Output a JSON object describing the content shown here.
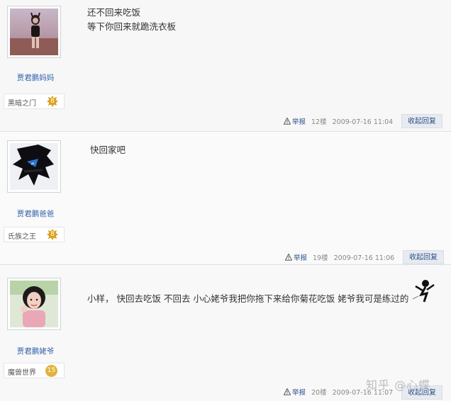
{
  "posts": [
    {
      "username": "贾君鹏妈妈",
      "group": "黑暗之门",
      "level": "8",
      "lines": [
        "还不回来吃饭",
        "等下你回来就跪洗衣板"
      ],
      "report": "举报",
      "floor": "12楼",
      "time": "2009-07-16 11:04",
      "collapse": "收起回复"
    },
    {
      "username": "贾君鹏爸爸",
      "group": "氏族之王",
      "level": "8",
      "lines": [
        "快回家吧"
      ],
      "report": "举报",
      "floor": "19楼",
      "time": "2009-07-16 11:06",
      "collapse": "收起回复"
    },
    {
      "username": "贾君鹏姥爷",
      "group": "魔兽世界",
      "level": "15",
      "lines": [
        "小样，  快回去吃饭   不回去 小心姥爷我把你拖下来给你菊花吃饭 姥爷我可是练过的"
      ],
      "report": "举报",
      "floor": "20楼",
      "time": "2009-07-16 11:07",
      "collapse": "收起回复"
    }
  ],
  "watermark": "知乎 @心蝶",
  "icons": {
    "report": "warning-triangle-icon",
    "level": "star-level-icon",
    "sticker": "ninja-sticker-icon"
  },
  "colors": {
    "username": "#2e5fa7",
    "link": "#2b4f8a",
    "level_badge": "#d9a11c"
  }
}
